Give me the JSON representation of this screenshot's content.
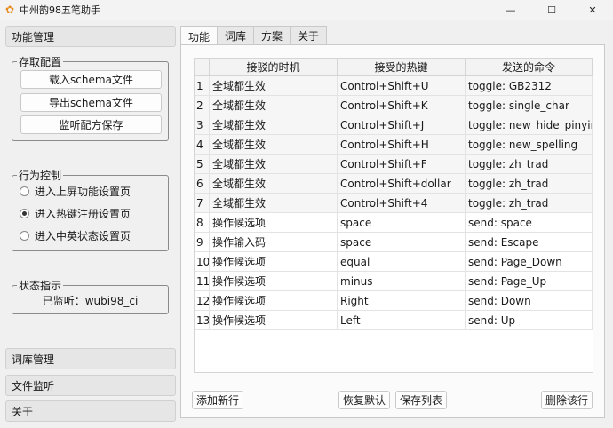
{
  "window": {
    "title": "中州韵98五笔助手",
    "minimize": "—",
    "maximize": "☐",
    "close": "✕"
  },
  "sidebar": {
    "function_manage": "功能管理",
    "dict_manage": "词库管理",
    "file_monitor": "文件监听",
    "about": "关于"
  },
  "access_group": {
    "title": "存取配置",
    "load_button": "载入schema文件",
    "export_button": "导出schema文件",
    "save_button": "监听配方保存"
  },
  "behavior_group": {
    "title": "行为控制",
    "options": [
      {
        "label": "进入上屏功能设置页",
        "selected": false
      },
      {
        "label": "进入热键注册设置页",
        "selected": true
      },
      {
        "label": "进入中英状态设置页",
        "selected": false
      }
    ]
  },
  "status_group": {
    "title": "状态指示",
    "text": "已监听：wubi98_ci"
  },
  "tabs": [
    "功能",
    "词库",
    "方案",
    "关于"
  ],
  "table": {
    "headers": [
      "接驳的时机",
      "接受的热键",
      "发送的命令"
    ],
    "rows": [
      {
        "n": "1",
        "when": "全域都生效",
        "key": "Control+Shift+U",
        "cmd": "toggle: GB2312"
      },
      {
        "n": "2",
        "when": "全域都生效",
        "key": "Control+Shift+K",
        "cmd": "toggle: single_char"
      },
      {
        "n": "3",
        "when": "全域都生效",
        "key": "Control+Shift+J",
        "cmd": "toggle: new_hide_pinyin"
      },
      {
        "n": "4",
        "when": "全域都生效",
        "key": "Control+Shift+H",
        "cmd": "toggle: new_spelling"
      },
      {
        "n": "5",
        "when": "全域都生效",
        "key": "Control+Shift+F",
        "cmd": "toggle: zh_trad"
      },
      {
        "n": "6",
        "when": "全域都生效",
        "key": "Control+Shift+dollar",
        "cmd": "toggle: zh_trad"
      },
      {
        "n": "7",
        "when": "全域都生效",
        "key": "Control+Shift+4",
        "cmd": "toggle: zh_trad"
      },
      {
        "n": "8",
        "when": "操作候选项",
        "key": "space",
        "cmd": "send: space"
      },
      {
        "n": "9",
        "when": "操作输入码",
        "key": "space",
        "cmd": "send: Escape"
      },
      {
        "n": "10",
        "when": "操作候选项",
        "key": "equal",
        "cmd": "send: Page_Down"
      },
      {
        "n": "11",
        "when": "操作候选项",
        "key": "minus",
        "cmd": "send: Page_Up"
      },
      {
        "n": "12",
        "when": "操作候选项",
        "key": "Right",
        "cmd": "send: Down"
      },
      {
        "n": "13",
        "when": "操作候选项",
        "key": "Left",
        "cmd": "send: Up"
      }
    ]
  },
  "panel_buttons": {
    "add": "添加新行",
    "restore": "恢复默认",
    "save": "保存列表",
    "delete": "删除该行"
  },
  "colors": {
    "app_icon": "#e88a1a",
    "background": "#f0f0f0"
  }
}
